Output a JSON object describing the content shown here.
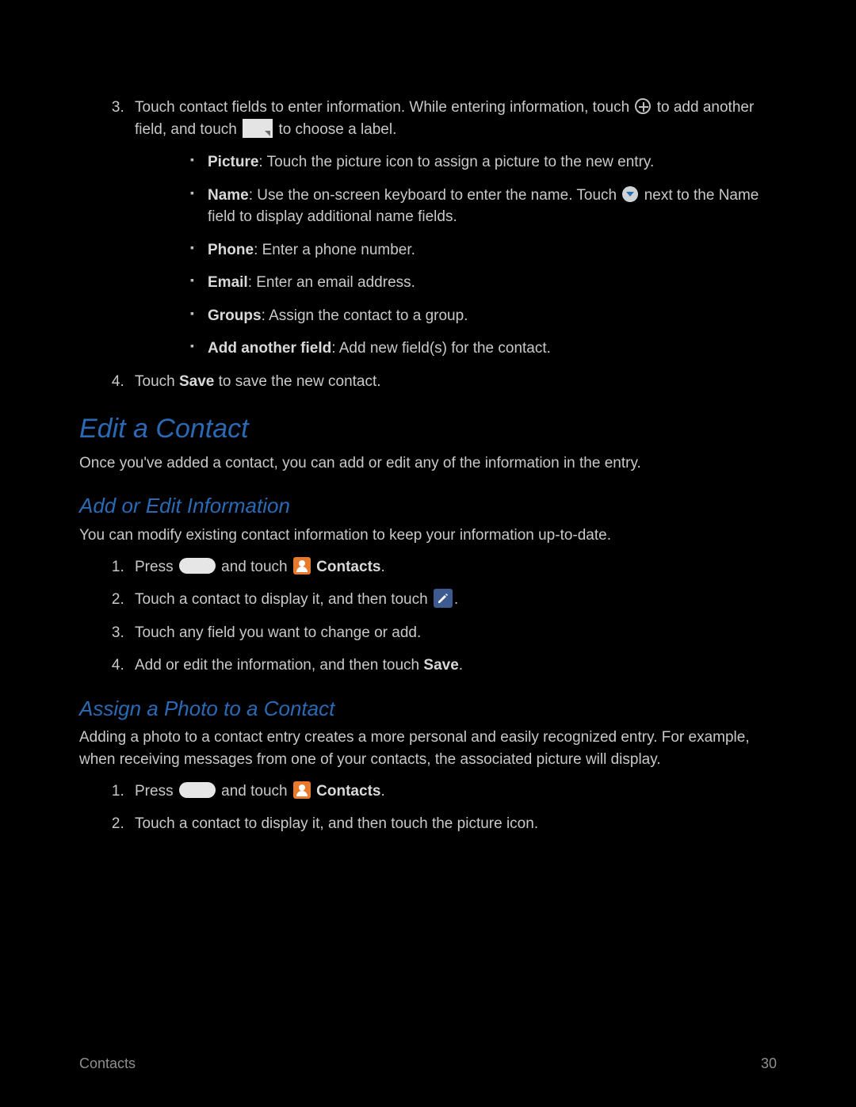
{
  "step3": {
    "a": "Touch contact fields to enter information. While entering information, touch ",
    "b": " to add another field, and touch ",
    "c": " to choose a label."
  },
  "bul": {
    "picture_b": "Picture",
    "picture_t": ": Touch the picture icon to assign a picture to the new entry.",
    "name_b": "Name",
    "name_t1": ": Use the on-screen keyboard to enter the name. Touch ",
    "name_t2": " next to the Name field to display additional name fields.",
    "phone_b": "Phone",
    "phone_t": ": Enter a phone number.",
    "email_b": "Email",
    "email_t": ": Enter an email address.",
    "groups_b": "Groups",
    "groups_t": ": Assign the contact to a group.",
    "add_b": "Add another field",
    "add_t": ": Add new field(s) for the contact."
  },
  "step4": {
    "a": "Touch ",
    "save": "Save",
    "b": " to save the new contact."
  },
  "edit_h": "Edit a Contact",
  "edit_p": "Once you've added a contact, you can add or edit any of the information in the entry.",
  "add_h": "Add or Edit Information",
  "add_p": "You can modify existing contact information to keep your information up-to-date.",
  "a1": {
    "a": "Press ",
    "b": " and touch ",
    "contacts": "Contacts",
    "c": "."
  },
  "a2": {
    "a": "Touch a contact to display it, and then touch ",
    "b": "."
  },
  "a3": "Touch any field you want to change or add.",
  "a4": {
    "a": "Add or edit the information, and then touch ",
    "save": "Save",
    "b": "."
  },
  "photo_h": "Assign a Photo to a Contact",
  "photo_p": "Adding a photo to a contact entry creates a more personal and easily recognized entry. For example, when receiving messages from one of your contacts, the associated picture will display.",
  "p1": {
    "a": "Press ",
    "b": " and touch ",
    "contacts": "Contacts",
    "c": "."
  },
  "p2": "Touch a contact to display it, and then touch the picture icon.",
  "footer_left": "Contacts",
  "footer_right": "30"
}
